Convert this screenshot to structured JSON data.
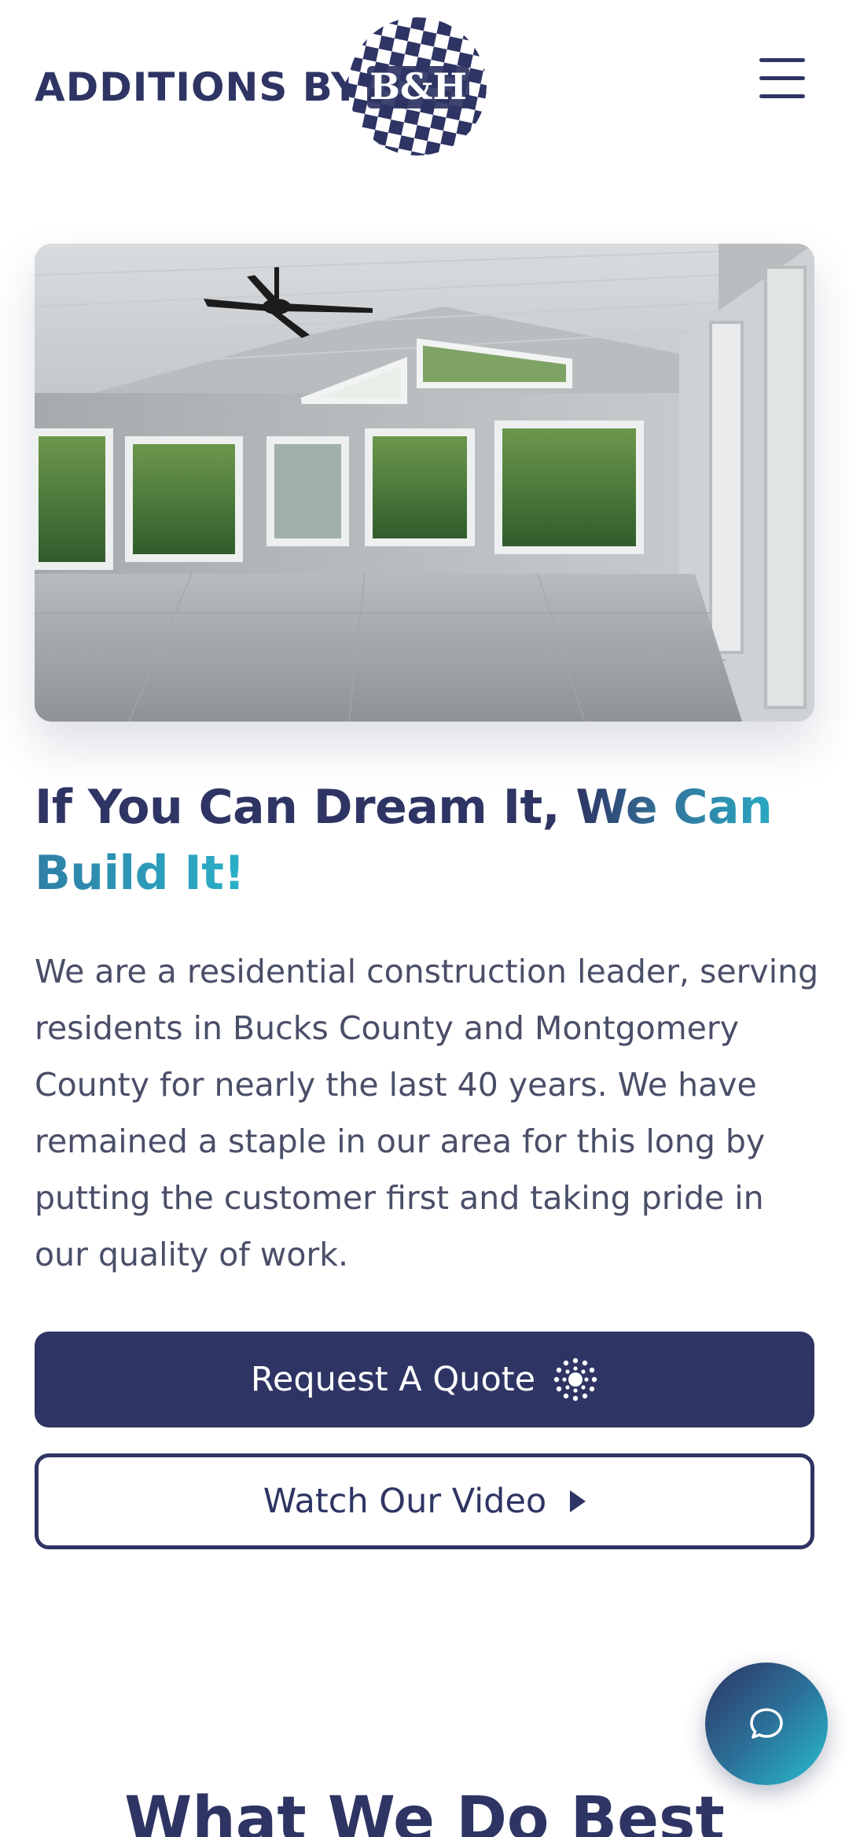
{
  "header": {
    "logo_text": "ADDITIONS BY",
    "logo_badge_text": "B&H",
    "menu_icon": "hamburger-menu-icon"
  },
  "hero": {
    "image_description": ""
  },
  "headline": {
    "part1": "If You Can Dream It, ",
    "part2": "We Can",
    "part3": "Build It!"
  },
  "intro_text": "We are a residential construction leader, serving residents in Bucks County and Montgomery County for nearly the last 40 years. We have remained a staple in our area for this long by putting the customer first and taking pride in our quality of work.",
  "buttons": {
    "request_quote": "Request A Quote",
    "request_quote_icon": "spinner-icon",
    "watch_video": "Watch Our Video",
    "watch_video_icon": "play-icon"
  },
  "chat": {
    "icon": "chat-bubble-icon"
  },
  "section": {
    "title": "What We Do Best"
  },
  "colors": {
    "brand_navy": "#2e3463",
    "brand_teal": "#29a8c2",
    "body_text": "#4a4e68"
  }
}
